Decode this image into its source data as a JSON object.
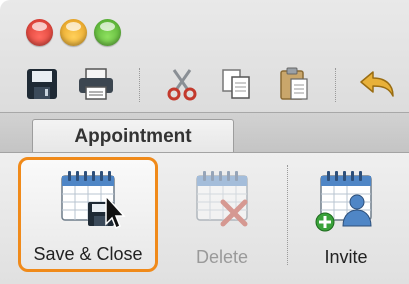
{
  "window": {
    "traffic_lights": [
      {
        "name": "close",
        "color": "#e0443e"
      },
      {
        "name": "minimize",
        "color": "#f3b43b"
      },
      {
        "name": "zoom",
        "color": "#69c23f"
      }
    ]
  },
  "toolbar": {
    "icons": [
      "save-icon",
      "print-icon",
      "cut-icon",
      "copy-icon",
      "paste-icon",
      "undo-icon"
    ]
  },
  "tabs": [
    {
      "label": "Appointment",
      "selected": true
    }
  ],
  "ribbon": {
    "save_close_label": "Save & Close",
    "delete_label": "Delete",
    "invite_label": "Invite"
  },
  "colors": {
    "highlight": "#f08a1a",
    "calendar_blue": "#4f86c6"
  }
}
